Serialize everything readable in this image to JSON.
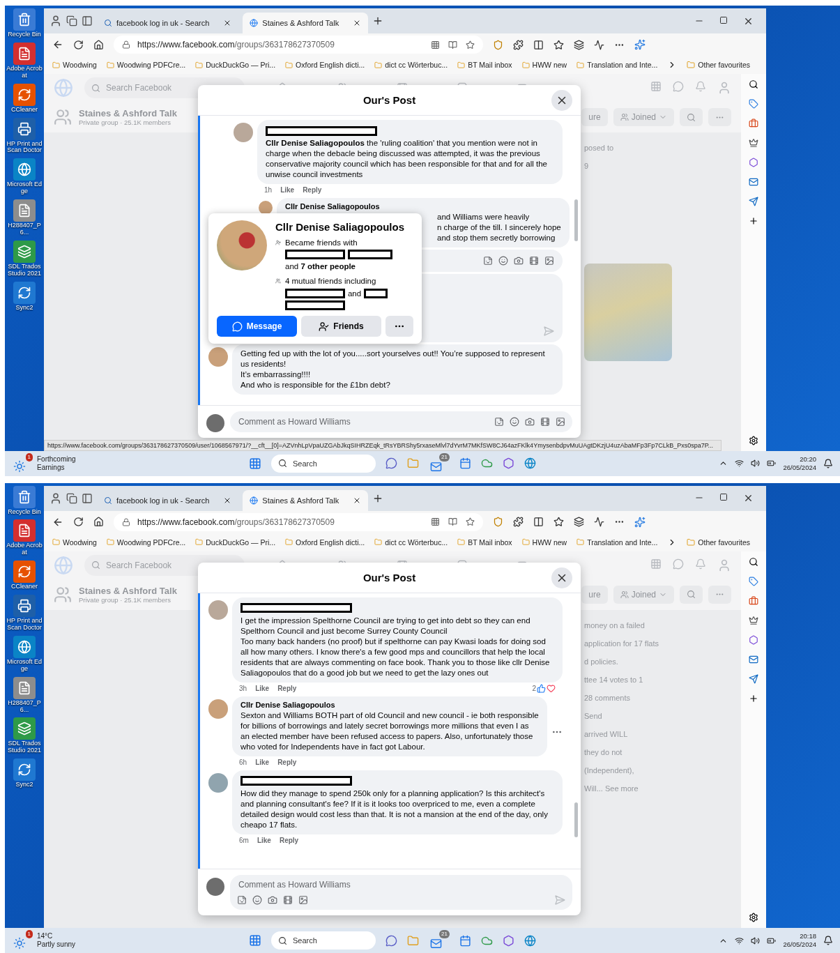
{
  "screens": [
    {
      "desktop_icons": [
        {
          "label": "Recycle Bin"
        },
        {
          "label": "Adobe Acrobat"
        },
        {
          "label": "CCleaner"
        },
        {
          "label": "HP Print and Scan Doctor"
        },
        {
          "label": "Microsoft Edge"
        },
        {
          "label": "H288407_P6..."
        },
        {
          "label": "SDL Trados Studio 2021"
        },
        {
          "label": "Sync2"
        }
      ],
      "browser": {
        "tabs": [
          {
            "label": "facebook log in uk - Search",
            "kind": "search",
            "selected": false
          },
          {
            "label": "Staines & Ashford Talk",
            "kind": "site",
            "selected": true
          }
        ],
        "address_host": "https://www.facebook.com",
        "address_path": "/groups/363178627370509",
        "bookmarks": [
          "Woodwing",
          "Woodwing PDFCre...",
          "DuckDuckGo — Pri...",
          "Oxford English dicti...",
          "dict cc  Wörterbuc...",
          "BT Mail inbox",
          "HWW new",
          "Translation and Inte..."
        ],
        "other_favourites": "Other favourites"
      },
      "page": {
        "search_placeholder": "Search Facebook",
        "group_name": "Staines & Ashford Talk",
        "group_meta": "Private group · 25.1K members",
        "header_button": "ure",
        "joined": "Joined",
        "background_items": [
          {
            "kind": "text",
            "text": "posed to"
          },
          {
            "kind": "count",
            "text": "9"
          },
          {
            "kind": "photo"
          }
        ]
      },
      "dialog": {
        "title": "Our's Post",
        "items": [
          {
            "kind": "reply",
            "author_redacted": true,
            "text": "**Cllr Denise Saliagopoulos** the 'ruling coalition' that you mention were not in charge when the debacle being discussed was attempted, it was the previous conservative majority council which has been responsible for that and for all the unwise council investments",
            "time": "1h",
            "like": "Like",
            "reply": "Reply"
          },
          {
            "kind": "nested_reply",
            "author_redacted": false,
            "author": "Cllr Denise Saliagopoulos",
            "visible_lines": [
              "and Williams were heavily",
              "n charge of the till. I sincerely hope",
              "and stop them secretly borrowing"
            ]
          },
          {
            "kind": "reply_box"
          },
          {
            "kind": "reply_draft"
          },
          {
            "kind": "comment",
            "author_redacted": false,
            "text": "Getting fed up with the lot of you.....sort yourselves out!! You’re supposed to represent us residents!\nIt’s embarrassing!!!!\nAnd who is responsible for the £1bn debt?"
          }
        ],
        "profile_card": {
          "name": "Cllr Denise Saliagopoulos",
          "lines": [
            {
              "kind": "friends",
              "parts": [
                {
                  "kind": "text",
                  "text": "Became friends with"
                },
                {
                  "kind": "redaction"
                },
                {
                  "kind": "redaction"
                },
                {
                  "kind": "text",
                  "text": "and **7 other people**"
                }
              ]
            },
            {
              "kind": "mutual",
              "parts": [
                {
                  "kind": "text",
                  "text": "4 mutual friends including"
                },
                {
                  "kind": "redaction"
                },
                {
                  "kind": "text",
                  "text": "and"
                },
                {
                  "kind": "redaction"
                },
                {
                  "kind": "redaction"
                }
              ]
            }
          ],
          "message": "Message",
          "friends": "Friends"
        },
        "composer": {
          "placeholder": "Comment as Howard Williams",
          "kind": "inline"
        }
      },
      "status_url": "https://www.facebook.com/groups/363178627370509/user/1068567971/?__cft__[0]=AZVnhLpVpaUZGAbJkqSIHRZEqk_tRsYBRShy5rxaseMlvl7dYvrM7MKfSW8CJ64azFKlk4YmysenbdpvMuUAgtDKzjU4uzAbaMFp3Fp7CLkB_Pxs0spa7P...",
      "taskbar": {
        "widget_title": "Forthcoming",
        "widget_sub": "Earnings",
        "widget_badge": "1",
        "search": "Search",
        "mail_badge": "21",
        "time": "20:20",
        "date": "26/05/2024"
      }
    },
    {
      "desktop_icons": [
        {
          "label": "Recycle Bin"
        },
        {
          "label": "Adobe Acrobat"
        },
        {
          "label": "CCleaner"
        },
        {
          "label": "HP Print and Scan Doctor"
        },
        {
          "label": "Microsoft Edge"
        },
        {
          "label": "H288407_P6..."
        },
        {
          "label": "SDL Trados Studio 2021"
        },
        {
          "label": "Sync2"
        }
      ],
      "browser": {
        "tabs": [
          {
            "label": "facebook log in uk - Search",
            "kind": "search",
            "selected": false
          },
          {
            "label": "Staines & Ashford Talk",
            "kind": "site",
            "selected": true
          }
        ],
        "address_host": "https://www.facebook.com",
        "address_path": "/groups/363178627370509",
        "bookmarks": [
          "Woodwing",
          "Woodwing PDFCre...",
          "DuckDuckGo — Pri...",
          "Oxford English dicti...",
          "dict cc  Wörterbuc...",
          "BT Mail inbox",
          "HWW new",
          "Translation and Inte..."
        ],
        "other_favourites": "Other favourites"
      },
      "page": {
        "search_placeholder": "Search Facebook",
        "group_name": "Staines & Ashford Talk",
        "group_meta": "Private group · 25.1K members",
        "header_button": "ure",
        "joined": "Joined",
        "background_items": [
          {
            "kind": "text",
            "text": "money on a failed"
          },
          {
            "kind": "text",
            "text": "application for 17 flats"
          },
          {
            "kind": "text",
            "text": "d policies."
          },
          {
            "kind": "text",
            "text": "ttee 14 votes to 1"
          },
          {
            "kind": "count",
            "text": "28 comments"
          },
          {
            "kind": "text",
            "text": "Send"
          },
          {
            "kind": "text",
            "text": "arrived WILL"
          },
          {
            "kind": "text",
            "text": "they do not"
          },
          {
            "kind": "text",
            "text": "(Independent),"
          },
          {
            "kind": "text",
            "text": "Will... See more"
          }
        ]
      },
      "dialog": {
        "title": "Our's Post",
        "items": [
          {
            "kind": "comment",
            "author_redacted": true,
            "text": "I get the impression Spelthorne Council are trying to get into debt so they can end Spelthorn Council and just become Surrey County Council\nToo many back handers (no proof) but if spelthorne can pay Kwasi loads for doing sod all how many others. I know there's a few good mps and councillors that help the local residents that are always commenting on face book. Thank you to those like cllr Denise Saliagopoulos that do a good job but we need to get the lazy ones out",
            "time": "3h",
            "like": "Like",
            "reply": "Reply",
            "reactions": "2"
          },
          {
            "kind": "comment",
            "author_redacted": false,
            "author": "Cllr Denise Saliagopoulos",
            "text": "Sexton and Williams BOTH part of old Council and new council - ie both responsible for billions of borrowings and lately secret borrowings more millions that even I as an elected member have been refused access to papers. Also, unfortunately those who voted for Independents have in fact got Labour.",
            "time": "6h",
            "like": "Like",
            "reply": "Reply"
          },
          {
            "kind": "comment",
            "author_redacted": true,
            "text": "How did they manage to spend 250k only for a planning application? Is this architect's and planning consultant's fee? If it is it looks too overpriced to me, even a complete detailed design would cost less than that. It is not a mansion at the end of the day, only cheapo 17 flats.",
            "time": "6m",
            "like": "Like",
            "reply": "Reply"
          }
        ],
        "composer": {
          "placeholder": "Comment as Howard Williams",
          "kind": "stacked"
        }
      },
      "taskbar": {
        "widget_title": "14°C",
        "widget_sub": "Partly sunny",
        "widget_badge": "1",
        "search": "Search",
        "mail_badge": "21",
        "time": "20:18",
        "date": "26/05/2024"
      }
    }
  ]
}
